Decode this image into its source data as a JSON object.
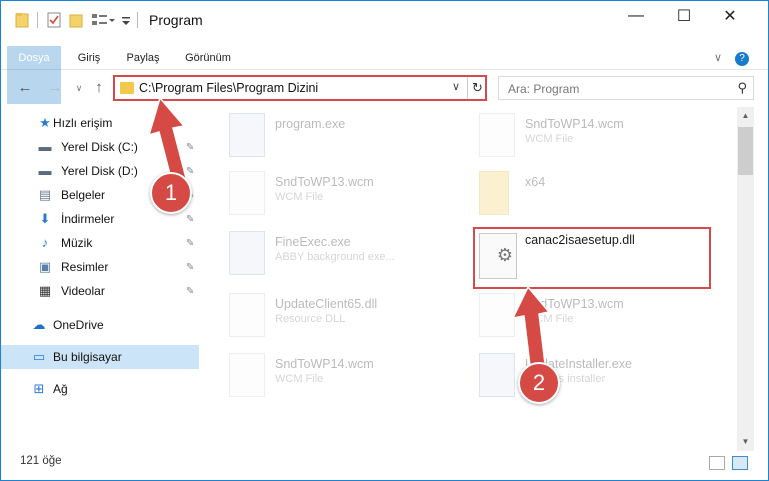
{
  "window": {
    "title": "Program",
    "minimize": "—",
    "maximize": "☐",
    "close": "✕"
  },
  "ribbon": {
    "tabs": [
      "Dosya",
      "Giriş",
      "Paylaş",
      "Görünüm"
    ],
    "collapse": "∨",
    "help": "?"
  },
  "address": {
    "path": "C:\\Program Files\\Program Dizini",
    "dropdown": "∨",
    "refresh": "↻"
  },
  "search": {
    "placeholder": "Ara: Program",
    "icon": "search-icon"
  },
  "nav": {
    "items": [
      {
        "label": "Hızlı erişim",
        "icon": "star-icon",
        "glyph": "★",
        "color": "#2b7bd2",
        "pinned": false
      },
      {
        "label": "Yerel Disk (C:)",
        "icon": "drive-icon",
        "glyph": "▬",
        "color": "#5a6b7d",
        "pinned": true
      },
      {
        "label": "Yerel Disk (D:)",
        "icon": "drive-icon",
        "glyph": "▬",
        "color": "#5a6b7d",
        "pinned": true
      },
      {
        "label": "Belgeler",
        "icon": "documents-icon",
        "glyph": "▤",
        "color": "#6b7c93",
        "pinned": true
      },
      {
        "label": "İndirmeler",
        "icon": "download-icon",
        "glyph": "⬇",
        "color": "#2b7bd2",
        "pinned": true
      },
      {
        "label": "Müzik",
        "icon": "music-icon",
        "glyph": "♪",
        "color": "#2b7bd2",
        "pinned": true
      },
      {
        "label": "Resimler",
        "icon": "pictures-icon",
        "glyph": "▣",
        "color": "#5b7fa8",
        "pinned": true
      },
      {
        "label": "Videolar",
        "icon": "video-icon",
        "glyph": "▦",
        "color": "#333",
        "pinned": true
      },
      {
        "label": "OneDrive",
        "icon": "cloud-icon",
        "glyph": "☁",
        "color": "#1f6fc9",
        "pinned": false
      },
      {
        "label": "Bu bilgisayar",
        "icon": "computer-icon",
        "glyph": "▭",
        "color": "#2b7bd2",
        "pinned": false,
        "selected": true
      },
      {
        "label": "Ağ",
        "icon": "network-icon",
        "glyph": "⊞",
        "color": "#2b7bd2",
        "pinned": false
      }
    ],
    "pin_glyph": "📌"
  },
  "files": [
    {
      "name": "program.exe",
      "type": "",
      "kind": "exe"
    },
    {
      "name": "SndToWP14.wcm",
      "type": "WCM File",
      "kind": "file"
    },
    {
      "name": "SndToWP13.wcm",
      "type": "WCM File",
      "kind": "file"
    },
    {
      "name": "x64",
      "type": "",
      "kind": "folder"
    },
    {
      "name": "FineExec.exe",
      "type": "ABBY background exe...",
      "kind": "exe"
    },
    {
      "name": "canac2isaesetup.dll",
      "type": "",
      "kind": "dll",
      "highlighted": true
    },
    {
      "name": "UpdateClient65.dll",
      "type": "Resource DLL",
      "kind": "dll"
    },
    {
      "name": "SndToWP13.wcm",
      "type": "WCM File",
      "kind": "file"
    },
    {
      "name": "SndToWP14.wcm",
      "type": "WCM File",
      "kind": "file"
    },
    {
      "name": "UpdateInstaller.exe",
      "type": "updates installer",
      "kind": "exe"
    }
  ],
  "status": {
    "item_count": "121 öğe"
  },
  "annotations": [
    {
      "label": "1"
    },
    {
      "label": "2"
    }
  ],
  "colors": {
    "accent": "#1979ca",
    "highlight_red": "#d74a4a",
    "selection": "#cce4f7"
  }
}
